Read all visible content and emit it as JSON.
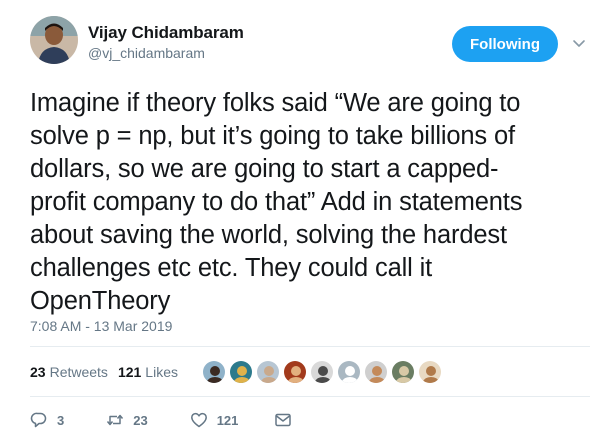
{
  "author": {
    "display_name": "Vijay Chidambaram",
    "handle": "@vj_chidambaram"
  },
  "follow_button": {
    "label": "Following",
    "color": "#1da1f2"
  },
  "tweet": {
    "lines": [
      "Imagine if theory folks said “We are going to",
      "solve p = np, but it’s going to take billions of",
      "dollars, so we are going to start a capped-",
      "profit company to do that” Add in statements",
      "about saving the world, solving the hardest",
      "challenges etc etc. They could call it",
      "OpenTheory"
    ],
    "timestamp": "7:08 AM - 13 Mar 2019"
  },
  "stats": {
    "retweets_count": "23",
    "retweets_label": "Retweets",
    "likes_count": "121",
    "likes_label": "Likes"
  },
  "facepile": {
    "avatars": [
      {
        "icon": "person-avatar",
        "bg": "#8fb2c9",
        "fg": "#3b2a22"
      },
      {
        "icon": "person-avatar",
        "bg": "#2c7a8c",
        "fg": "#e0b24a"
      },
      {
        "icon": "person-avatar",
        "bg": "#b7c6d3",
        "fg": "#c9a98c"
      },
      {
        "icon": "person-avatar",
        "bg": "#a23a1c",
        "fg": "#e2b07f"
      },
      {
        "icon": "person-avatar",
        "bg": "#d9d9d9",
        "fg": "#4a4a4a"
      },
      {
        "icon": "default-avatar",
        "bg": "#aab8c2",
        "fg": "#ffffff"
      },
      {
        "icon": "person-avatar",
        "bg": "#cfcfcf",
        "fg": "#c48a5a"
      },
      {
        "icon": "person-avatar",
        "bg": "#6a7d62",
        "fg": "#d8c9a6"
      },
      {
        "icon": "person-avatar",
        "bg": "#e8d9c2",
        "fg": "#b07a4a"
      }
    ]
  },
  "actions": {
    "reply_count": "3",
    "retweet_count": "23",
    "like_count": "121",
    "icons": [
      "reply-icon",
      "retweet-icon",
      "like-icon",
      "direct-message-icon"
    ]
  }
}
